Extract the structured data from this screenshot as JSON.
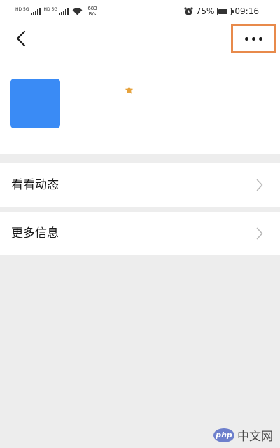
{
  "status_bar": {
    "sim1_label": "HD 5G",
    "sim2_label": "HD 5G",
    "net_speed_value": "683",
    "net_speed_unit": "B/s",
    "battery_percent": "75%",
    "time": "09:16",
    "icons": [
      "signal-icon",
      "signal-icon",
      "wifi-icon",
      "alarm-icon",
      "battery-icon"
    ]
  },
  "header": {
    "back_icon": "chevron-left-icon",
    "more_icon": "more-dots-icon",
    "more_highlight_color": "#e88a4b",
    "avatar_color": "#3a8bf5",
    "star_color": "#e6a23c"
  },
  "menu": {
    "items": [
      {
        "label": "看看动态"
      },
      {
        "label": "更多信息"
      }
    ]
  },
  "watermark": {
    "logo_text": "php",
    "text": "中文网"
  }
}
